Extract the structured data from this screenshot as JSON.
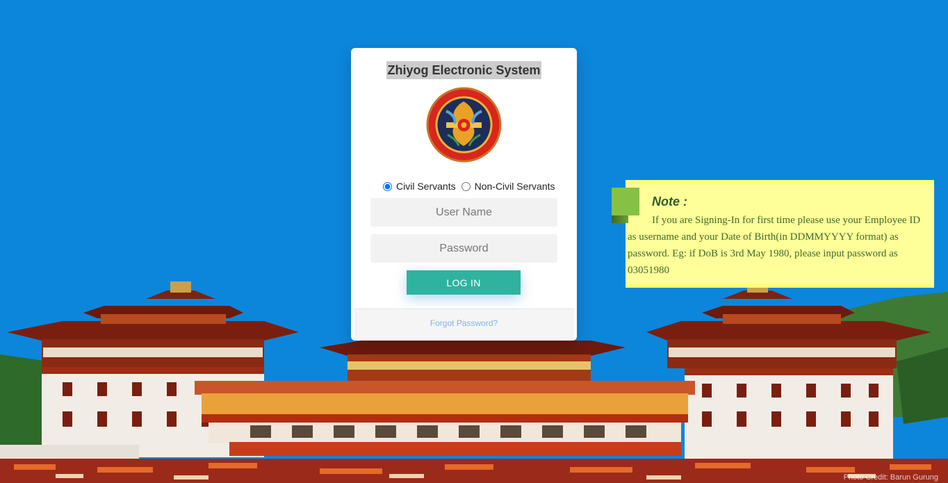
{
  "login": {
    "title": "Zhiyog Electronic System",
    "user_type_options": [
      {
        "label": "Civil Servants",
        "selected": true
      },
      {
        "label": "Non-Civil Servants",
        "selected": false
      }
    ],
    "username_placeholder": "User Name",
    "password_placeholder": "Password",
    "login_button": "LOG IN",
    "forgot_password": "Forgot Password?"
  },
  "note": {
    "heading": "Note :",
    "body": "If you are Signing-In for first time please use your Employee ID as username and your Date of Birth(in DDMMYYYY format) as password. Eg: if DoB is 3rd May 1980, please input password as 03051980"
  },
  "background": {
    "photo_credit": "Photo Credit: Barun Gurung"
  },
  "colors": {
    "sky": "#0c86db",
    "login_button": "#2fb3a0",
    "note_bg": "#ffff99",
    "note_accent": "#86c144"
  },
  "icons": {
    "logo": "royal-civil-service-commission-emblem"
  }
}
